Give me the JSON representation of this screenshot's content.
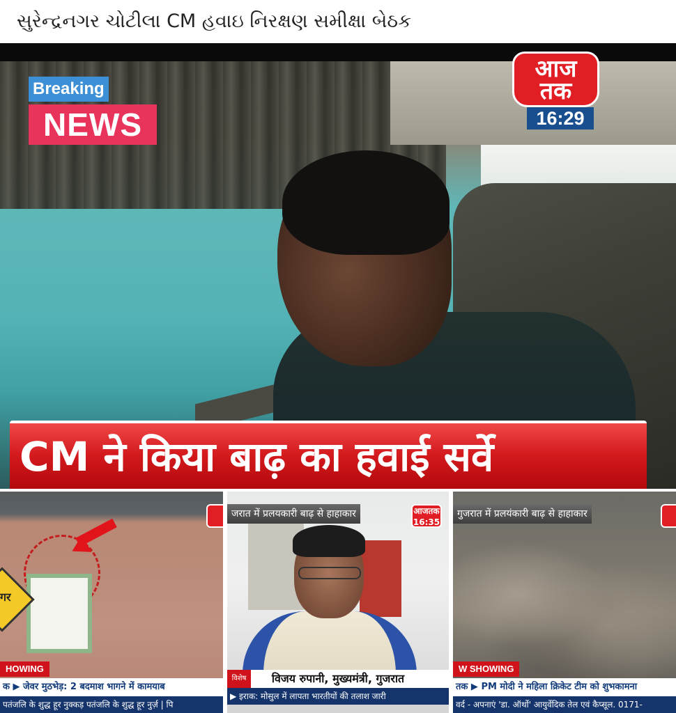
{
  "post": {
    "caption": "સુરેન્દ્રનગર ચોટીલા CM હવાઇ નિરક્ષણ સમીક્ષા બેઠક"
  },
  "main_video": {
    "badge": {
      "top": "Breaking",
      "bottom": "NEWS"
    },
    "channel_logo": {
      "line1": "आज",
      "line2": "तक"
    },
    "clock": "16:29",
    "headline": "CM ने किया बाढ़ का हवाई सर्वे"
  },
  "thumbnails": [
    {
      "road_sign_text": "गर",
      "showing_label": "HOWING",
      "ticker": "क ▶ जेवर मुठभेड़: 2 बदमाश भागने में कामयाब",
      "ticker2": "पतंजलि के शुद्ध हूर नुक्कड़ पतंजलि के शुद्ध हूर नुर्ज़ | पि"
    },
    {
      "top_ticker": "जरात में प्रलयकारी बाढ़ से हाहाकार",
      "logo": {
        "line1": "आज",
        "line2": "तक",
        "clock": "16:35"
      },
      "channel_tag": "विशेष",
      "nameplate": "विजय रुपानी, मुख्यमंत्री, गुजरात",
      "ticker2": "▶ इराक: मोसुल में लापता भारतीयों की तलाश जारी"
    },
    {
      "top_ticker": "गुजरात में प्रलयंकारी बाढ़ से हाहाकार",
      "showing_label": "W SHOWING",
      "ticker": "तक ▶ PM मोदी ने महिला क्रिकेट टीम को शुभकामना",
      "ticker2": "वर्द - अपनाएं 'डा. ऑर्थो' आयुर्वेदिक तेल एवं कैप्सूल. 0171-"
    }
  ],
  "colors": {
    "headline_red": "#d2191c",
    "breaking_blue": "#3d8fd6",
    "news_pink": "#e8335b",
    "clock_blue": "#1a4f8f",
    "channel_red": "#e01e24"
  },
  "icons": [
    "red-arrow-icon",
    "road-sign-icon"
  ]
}
